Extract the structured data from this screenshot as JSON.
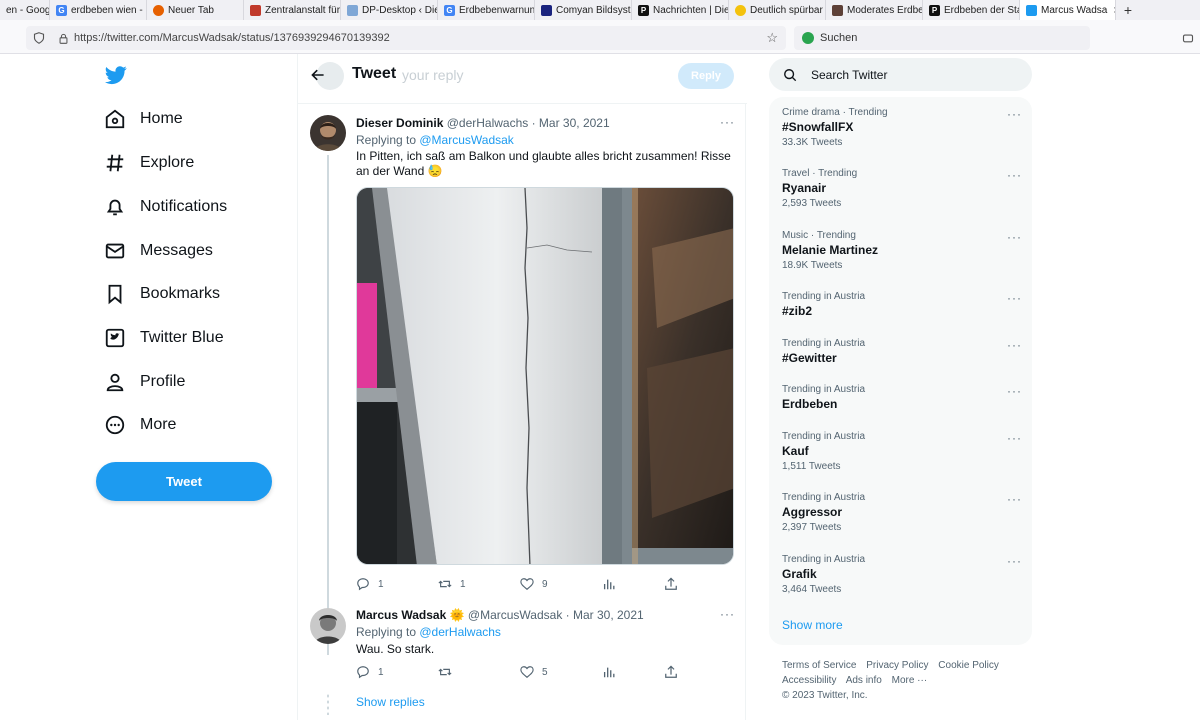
{
  "browser": {
    "tabs": [
      {
        "label": "en - Goog",
        "color": "#4285f4"
      },
      {
        "label": "erdbeben wien -",
        "color": "#4285f4"
      },
      {
        "label": "Neuer Tab",
        "color": "#e66000"
      },
      {
        "label": "Zentralanstalt für",
        "color": "#c0392b"
      },
      {
        "label": "DP-Desktop ‹ Die",
        "color": "#7fa7d6"
      },
      {
        "label": "Erdbebenwarnun",
        "color": "#4285f4"
      },
      {
        "label": "Comyan Bildsyst",
        "color": "#1a237e"
      },
      {
        "label": "Nachrichten | Die",
        "color": "#111111"
      },
      {
        "label": "Deutlich spürbar",
        "color": "#f4c20d"
      },
      {
        "label": "Moderates Erdbe",
        "color": "#5d4037"
      },
      {
        "label": "Erdbeben der Sta",
        "color": "#111111"
      },
      {
        "label": "Marcus Wadsa",
        "color": "#1d9bf0"
      }
    ],
    "url": "https://twitter.com/MarcusWadsak/status/1376939294670139392",
    "search_placeholder": "Suchen"
  },
  "sidebar": {
    "items": [
      {
        "label": "Home",
        "icon": "home-icon"
      },
      {
        "label": "Explore",
        "icon": "hashtag-icon"
      },
      {
        "label": "Notifications",
        "icon": "bell-icon"
      },
      {
        "label": "Messages",
        "icon": "envelope-icon"
      },
      {
        "label": "Bookmarks",
        "icon": "bookmark-icon"
      },
      {
        "label": "Twitter Blue",
        "icon": "twitter-blue-icon"
      },
      {
        "label": "Profile",
        "icon": "person-icon"
      },
      {
        "label": "More",
        "icon": "more-circle-icon"
      }
    ],
    "tweet_button": "Tweet"
  },
  "main": {
    "header_title": "Tweet",
    "reply_placeholder": "your reply",
    "reply_button": "Reply",
    "tweets": [
      {
        "name": "Dieser Dominik",
        "meta": "@derHalwachs · Mar 30, 2021",
        "replying_prefix": "Replying to ",
        "replying_to": "@MarcusWadsak",
        "text": "In Pitten,  ich saß am Balkon und glaubte alles bricht zusammen! Risse an der Wand 😓",
        "replies": "1",
        "retweets": "1",
        "likes": "9"
      },
      {
        "name": "Marcus Wadsak 🌞",
        "meta": "@MarcusWadsak · Mar 30, 2021",
        "replying_prefix": "Replying to ",
        "replying_to": "@derHalwachs",
        "text": "Wau. So stark.",
        "replies": "1",
        "retweets": "",
        "likes": "5"
      }
    ],
    "show_replies": "Show replies"
  },
  "right": {
    "search_placeholder": "Search Twitter",
    "trends": [
      {
        "category": "Crime drama · Trending",
        "name": "#SnowfallFX",
        "count": "33.3K Tweets"
      },
      {
        "category": "Travel · Trending",
        "name": "Ryanair",
        "count": "2,593 Tweets"
      },
      {
        "category": "Music · Trending",
        "name": "Melanie Martinez",
        "count": "18.9K Tweets"
      },
      {
        "category": "Trending in Austria",
        "name": "#zib2",
        "count": ""
      },
      {
        "category": "Trending in Austria",
        "name": "#Gewitter",
        "count": ""
      },
      {
        "category": "Trending in Austria",
        "name": "Erdbeben",
        "count": ""
      },
      {
        "category": "Trending in Austria",
        "name": "Kauf",
        "count": "1,511 Tweets"
      },
      {
        "category": "Trending in Austria",
        "name": "Aggressor",
        "count": "2,397 Tweets"
      },
      {
        "category": "Trending in Austria",
        "name": "Grafik",
        "count": "3,464 Tweets"
      }
    ],
    "show_more": "Show more",
    "footer": {
      "terms": "Terms of Service",
      "privacy": "Privacy Policy",
      "cookie": "Cookie Policy",
      "accessibility": "Accessibility",
      "ads": "Ads info",
      "more": "More ···",
      "copyright": "© 2023 Twitter, Inc."
    }
  },
  "colors": {
    "accent": "#1d9bf0",
    "text": "#0f1419",
    "muted": "#536471"
  }
}
